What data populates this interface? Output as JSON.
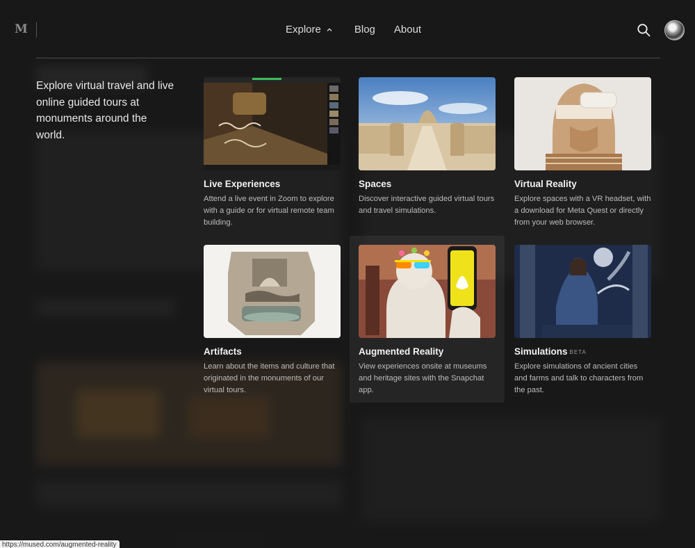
{
  "header": {
    "logo": "M",
    "nav": {
      "explore_label": "Explore",
      "blog_label": "Blog",
      "about_label": "About"
    }
  },
  "intro": "Explore virtual travel and live online guided tours at monuments around the world.",
  "cards": [
    {
      "title": "Live Experiences",
      "description": "Attend a live event in Zoom to explore with a guide or for virtual remote team building."
    },
    {
      "title": "Spaces",
      "description": "Discover interactive guided virtual tours and travel simulations."
    },
    {
      "title": "Virtual Reality",
      "description": "Explore spaces with a VR headset, with a download for Meta Quest or directly from your web browser."
    },
    {
      "title": "Artifacts",
      "description": "Learn about the items and culture that originated in the monuments of our virtual tours."
    },
    {
      "title": "Augmented Reality",
      "description": "View experiences onsite at museums and heritage sites with the Snapchat app."
    },
    {
      "title": "Simulations",
      "badge": "BETA",
      "description": "Explore simulations of ancient cities and farms and talk to characters from the past."
    }
  ],
  "status_bar": {
    "url": "https://mused.com/augmented-reality"
  },
  "icons": {
    "search": "search-icon",
    "chevron": "chevron-up-icon",
    "avatar": "avatar"
  },
  "colors": {
    "background": "#1c1c1c",
    "text": "#e9e9e9",
    "muted": "#bdbdbd"
  }
}
